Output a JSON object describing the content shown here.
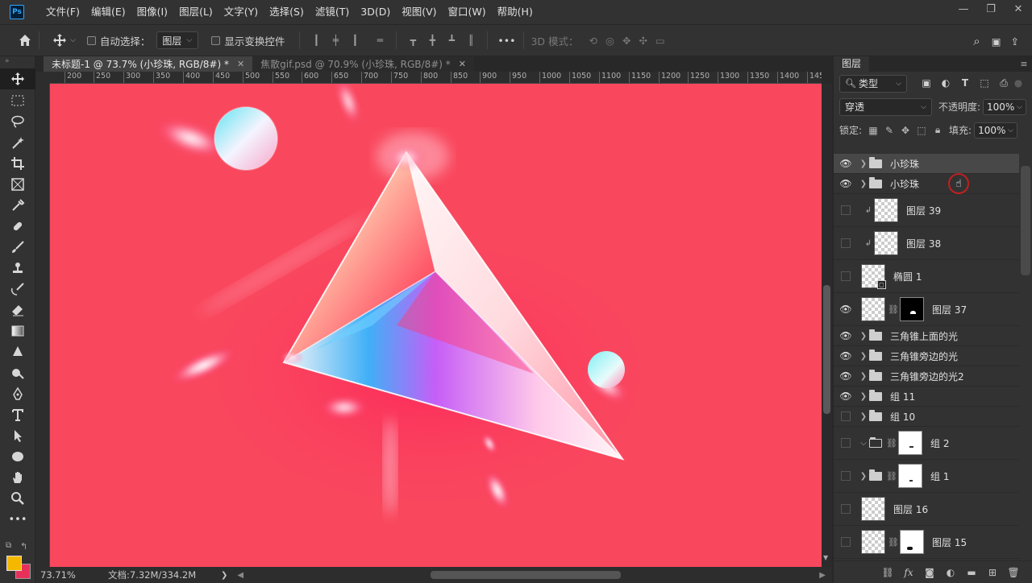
{
  "app": {
    "logo": "Ps"
  },
  "menus": [
    "文件(F)",
    "编辑(E)",
    "图像(I)",
    "图层(L)",
    "文字(Y)",
    "选择(S)",
    "滤镜(T)",
    "3D(D)",
    "视图(V)",
    "窗口(W)",
    "帮助(H)"
  ],
  "window_controls": {
    "minimize": "—",
    "restore": "❐",
    "close": "✕"
  },
  "options": {
    "auto_select_label": "自动选择：",
    "auto_select_target": "图层",
    "show_transform_label": "显示变换控件",
    "more": "•••",
    "mode_3d_label": "3D 模式："
  },
  "tabs": [
    {
      "label": "未标题-1 @ 73.7% (小珍珠, RGB/8#) *",
      "active": true
    },
    {
      "label": "焦散gif.psd @ 70.9% (小珍珠, RGB/8#) *",
      "active": false
    }
  ],
  "ruler": [
    "200",
    "250",
    "300",
    "350",
    "400",
    "450",
    "500",
    "550",
    "600",
    "650",
    "700",
    "750",
    "800",
    "850",
    "900",
    "950",
    "1000",
    "1050",
    "1100",
    "1150",
    "1200",
    "1250",
    "1300",
    "1350",
    "1400",
    "145"
  ],
  "status": {
    "zoom": "73.71%",
    "doc": "文档:7.32M/334.2M",
    "arrow": "❯"
  },
  "layers_panel": {
    "title": "图层",
    "filter_kind": "类型",
    "blend_mode": "穿透",
    "opacity_label": "不透明度:",
    "opacity": "100%",
    "lock_label": "锁定:",
    "fill_label": "填充:",
    "fill": "100%"
  },
  "layers": [
    {
      "name": "小珍珠",
      "type": "group",
      "visible": true,
      "selected": true
    },
    {
      "name": "小珍珠",
      "type": "group",
      "visible": true
    },
    {
      "name": "图层 39",
      "type": "layer",
      "visible": false,
      "clipped": true
    },
    {
      "name": "图层 38",
      "type": "layer",
      "visible": false,
      "clipped": true
    },
    {
      "name": "椭圆 1",
      "type": "shape",
      "visible": false
    },
    {
      "name": "图层 37",
      "type": "masked",
      "visible": true
    },
    {
      "name": "三角锥上面的光",
      "type": "group",
      "visible": true
    },
    {
      "name": "三角锥旁边的光",
      "type": "group",
      "visible": true
    },
    {
      "name": "三角锥旁边的光2",
      "type": "group",
      "visible": true
    },
    {
      "name": "组 11",
      "type": "group",
      "visible": true
    },
    {
      "name": "组 10",
      "type": "group",
      "visible": false
    },
    {
      "name": "组 2",
      "type": "group-open-mask",
      "visible": false
    },
    {
      "name": "组 1",
      "type": "group-mask",
      "visible": false
    },
    {
      "name": "图层 16",
      "type": "layer",
      "visible": false
    },
    {
      "name": "图层 15",
      "type": "masked",
      "visible": false
    }
  ],
  "colors": {
    "canvas": "#f9485e",
    "foreground": "#f5b800",
    "background": "#e8315a"
  }
}
